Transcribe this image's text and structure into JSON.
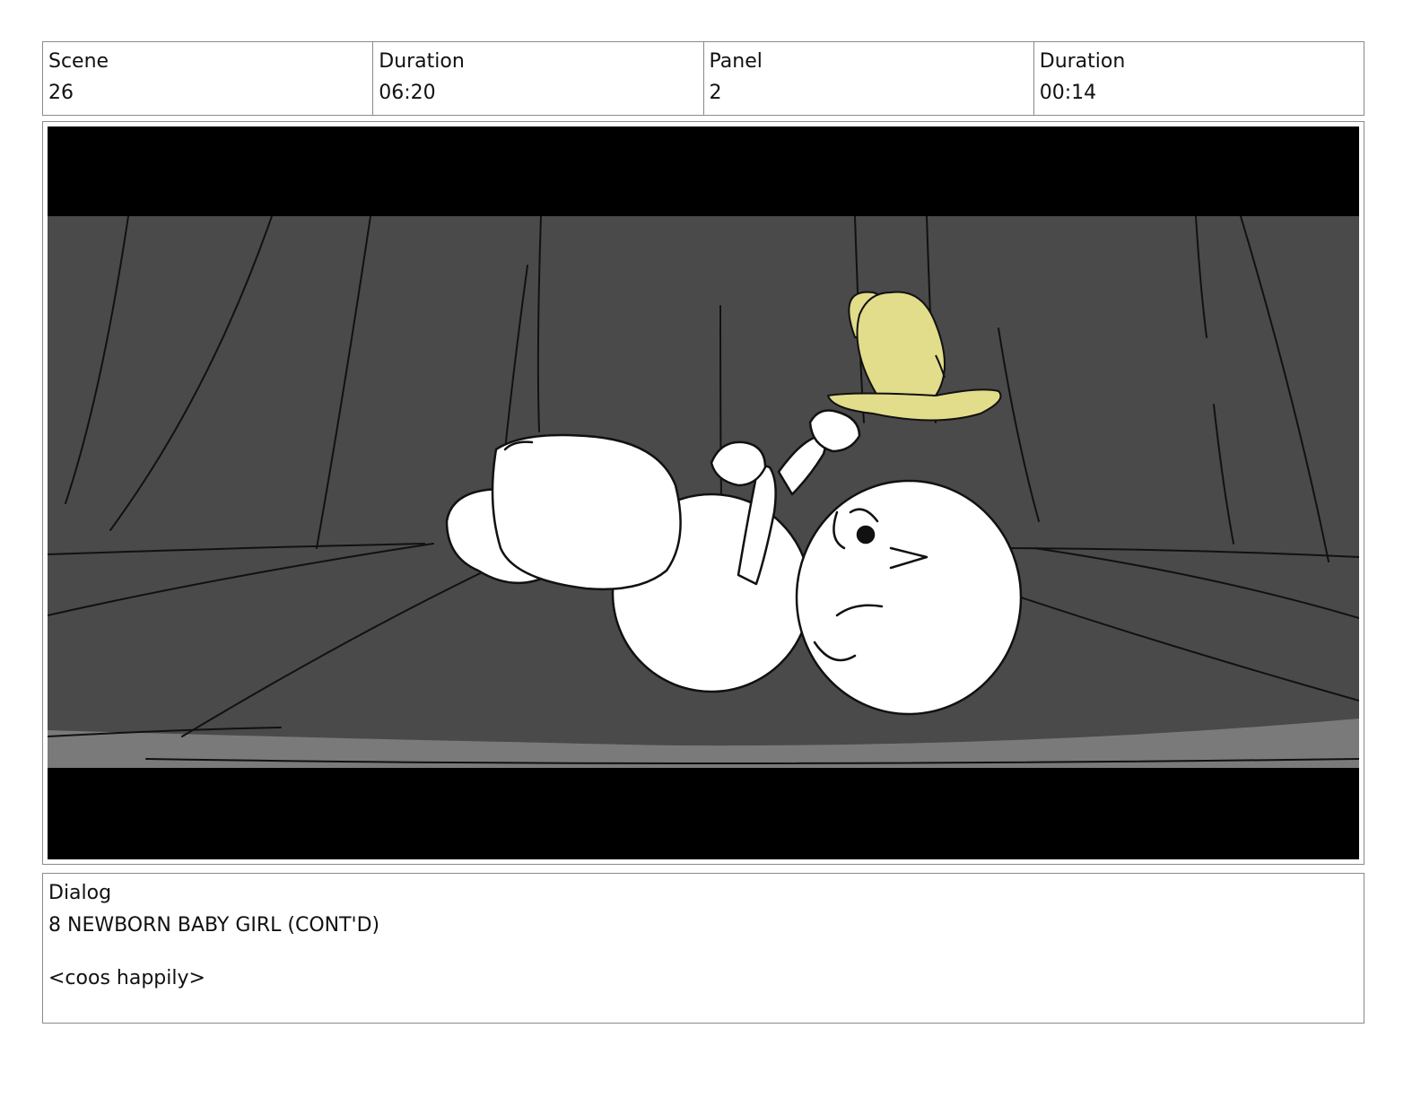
{
  "header": {
    "scene_label": "Scene",
    "scene_value": "26",
    "scene_duration_label": "Duration",
    "scene_duration_value": "06:20",
    "panel_label": "Panel",
    "panel_value": "2",
    "panel_duration_label": "Duration",
    "panel_duration_value": "00:14"
  },
  "panel": {
    "colors": {
      "letterbox": "#000000",
      "backdrop": "#4a4a4a",
      "floor_strip": "#7a7a7a",
      "baby": "#ffffff",
      "butterfly": "#e2dd8a",
      "ink": "#111111"
    }
  },
  "dialog": {
    "label": "Dialog",
    "character_line": "8 NEWBORN BABY GIRL (CONT'D)",
    "action_line": "<coos happily>"
  }
}
